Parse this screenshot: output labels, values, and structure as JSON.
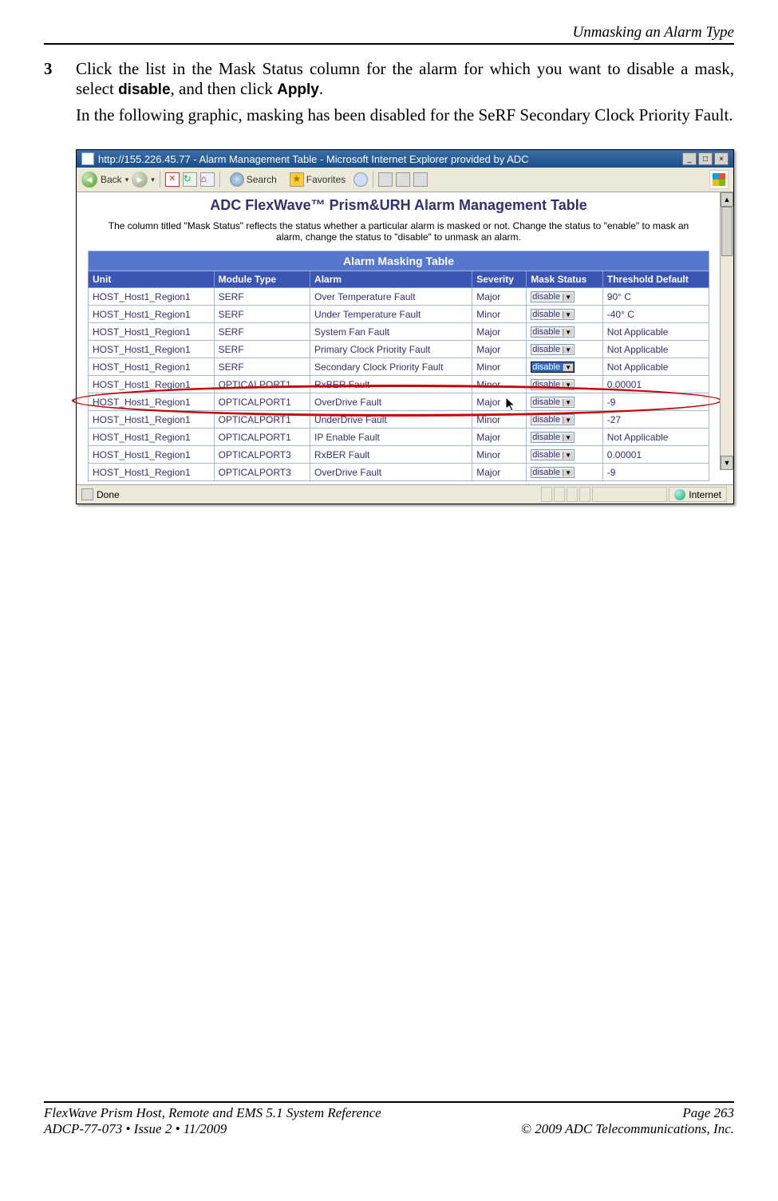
{
  "doc": {
    "header": "Unmasking an Alarm Type",
    "step_num": "3",
    "step_text_a": "Click the list in the Mask Status column for the alarm for which you want to disable a mask, select ",
    "step_bold1": "disable",
    "step_text_b": ", and then click ",
    "step_bold2": "Apply",
    "step_text_c": ".",
    "para": "In the following graphic, masking has been disabled for the SeRF Secondary Clock Priority Fault.",
    "footer_l1": "FlexWave Prism Host, Remote and EMS 5.1 System Reference",
    "footer_r1": "Page 263",
    "footer_l2": "ADCP-77-073  •  Issue 2  •  11/2009",
    "footer_r2": "© 2009 ADC Telecommunications, Inc."
  },
  "win": {
    "title": "http://155.226.45.77 - Alarm Management Table - Microsoft Internet Explorer provided by ADC",
    "back": "Back",
    "search": "Search",
    "fav": "Favorites",
    "status_done": "Done",
    "status_zone": "Internet"
  },
  "page": {
    "title": "ADC FlexWave™ Prism&URH Alarm Management Table",
    "instr": "The column titled \"Mask Status\" reflects the status whether a particular alarm is masked or not. Change the status to \"enable\" to mask an alarm, change the status to \"disable\" to unmask an alarm.",
    "caption": "Alarm Masking Table",
    "cols": [
      "Unit",
      "Module Type",
      "Alarm",
      "Severity",
      "Mask Status",
      "Threshold Default"
    ],
    "rows": [
      {
        "u": "HOST_Host1_Region1",
        "m": "SERF",
        "a": "Over Temperature Fault",
        "s": "Major",
        "ms": "disable",
        "t": "90° C",
        "hl": false
      },
      {
        "u": "HOST_Host1_Region1",
        "m": "SERF",
        "a": "Under Temperature Fault",
        "s": "Minor",
        "ms": "disable",
        "t": "-40° C",
        "hl": false
      },
      {
        "u": "HOST_Host1_Region1",
        "m": "SERF",
        "a": "System Fan Fault",
        "s": "Major",
        "ms": "disable",
        "t": "Not Applicable",
        "hl": false
      },
      {
        "u": "HOST_Host1_Region1",
        "m": "SERF",
        "a": "Primary Clock Priority Fault",
        "s": "Major",
        "ms": "disable",
        "t": "Not Applicable",
        "hl": false
      },
      {
        "u": "HOST_Host1_Region1",
        "m": "SERF",
        "a": "Secondary Clock Priority Fault",
        "s": "Minor",
        "ms": "disable",
        "t": "Not Applicable",
        "hl": true
      },
      {
        "u": "HOST_Host1_Region1",
        "m": "OPTICALPORT1",
        "a": "RxBER Fault",
        "s": "Minor",
        "ms": "disable",
        "t": "0.00001",
        "hl": false
      },
      {
        "u": "HOST_Host1_Region1",
        "m": "OPTICALPORT1",
        "a": "OverDrive Fault",
        "s": "Major",
        "ms": "disable",
        "t": "-9",
        "hl": false
      },
      {
        "u": "HOST_Host1_Region1",
        "m": "OPTICALPORT1",
        "a": "UnderDrive Fault",
        "s": "Minor",
        "ms": "disable",
        "t": "-27",
        "hl": false
      },
      {
        "u": "HOST_Host1_Region1",
        "m": "OPTICALPORT1",
        "a": "IP Enable Fault",
        "s": "Major",
        "ms": "disable",
        "t": "Not Applicable",
        "hl": false
      },
      {
        "u": "HOST_Host1_Region1",
        "m": "OPTICALPORT3",
        "a": "RxBER Fault",
        "s": "Minor",
        "ms": "disable",
        "t": "0.00001",
        "hl": false
      },
      {
        "u": "HOST_Host1_Region1",
        "m": "OPTICALPORT3",
        "a": "OverDrive Fault",
        "s": "Major",
        "ms": "disable",
        "t": "-9",
        "hl": false
      }
    ]
  }
}
